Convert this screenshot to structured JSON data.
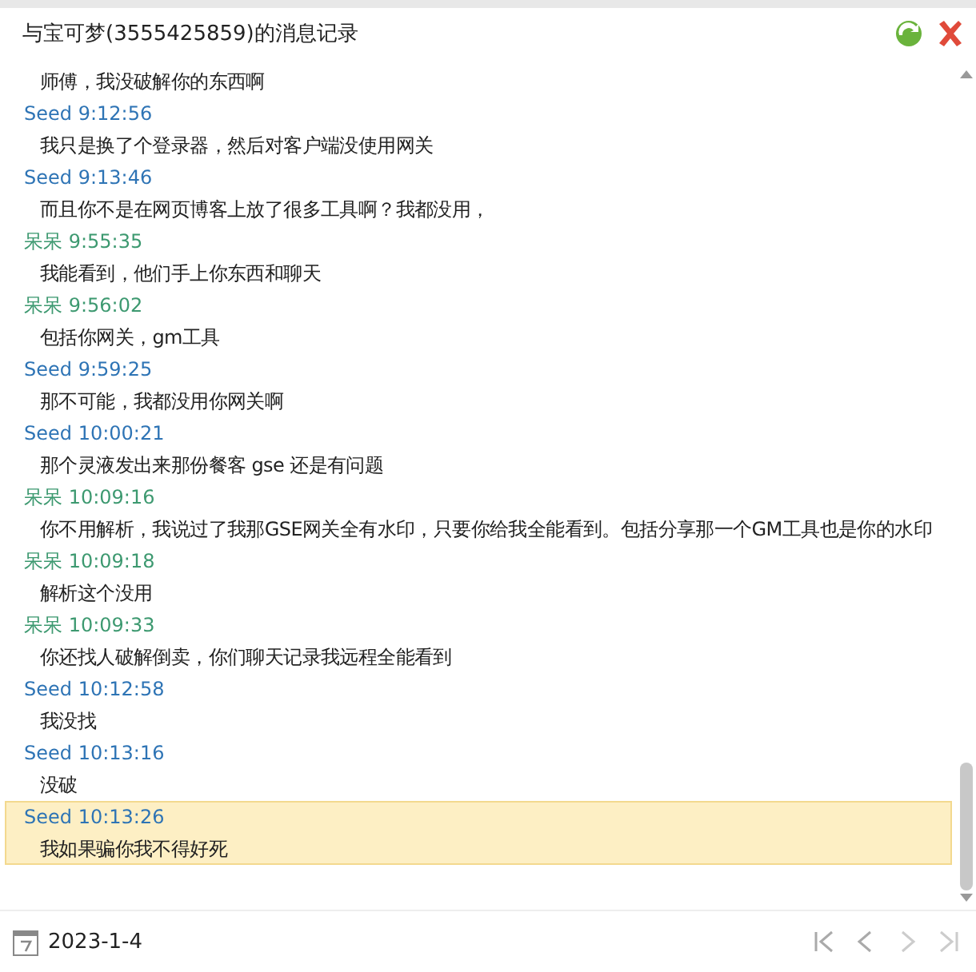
{
  "window": {
    "title": "与宝可梦(3555425859)的消息记录"
  },
  "messages": [
    {
      "text": "师傅，我没破解你的东西啊",
      "selected": false
    },
    {
      "sender": "Seed",
      "time": "9:12:56",
      "color": "#2e74b5",
      "text": "我只是换了个登录器，然后对客户端没使用网关",
      "selected": false
    },
    {
      "sender": "Seed",
      "time": "9:13:46",
      "color": "#2e74b5",
      "text": "而且你不是在网页博客上放了很多工具啊？我都没用，",
      "selected": false
    },
    {
      "sender": "呆呆",
      "time": "9:55:35",
      "color": "#3d9970",
      "text": "我能看到，他们手上你东西和聊天",
      "selected": false
    },
    {
      "sender": "呆呆",
      "time": "9:56:02",
      "color": "#3d9970",
      "text": "包括你网关，gm工具",
      "selected": false
    },
    {
      "sender": "Seed",
      "time": "9:59:25",
      "color": "#2e74b5",
      "text": "那不可能，我都没用你网关啊",
      "selected": false
    },
    {
      "sender": "Seed",
      "time": "10:00:21",
      "color": "#2e74b5",
      "text": "那个灵液发出来那份餐客 gse 还是有问题",
      "selected": false
    },
    {
      "sender": "呆呆",
      "time": "10:09:16",
      "color": "#3d9970",
      "text": "你不用解析，我说过了我那GSE网关全有水印，只要你给我全能看到。包括分享那一个GM工具也是你的水印",
      "selected": false
    },
    {
      "sender": "呆呆",
      "time": "10:09:18",
      "color": "#3d9970",
      "text": "解析这个没用",
      "selected": false
    },
    {
      "sender": "呆呆",
      "time": "10:09:33",
      "color": "#3d9970",
      "text": "你还找人破解倒卖，你们聊天记录我远程全能看到",
      "selected": false
    },
    {
      "sender": "Seed",
      "time": "10:12:58",
      "color": "#2e74b5",
      "text": "我没找",
      "selected": false
    },
    {
      "sender": "Seed",
      "time": "10:13:16",
      "color": "#2e74b5",
      "text": "没破",
      "selected": false
    },
    {
      "sender": "Seed",
      "time": "10:13:26",
      "color": "#2e74b5",
      "text": "我如果骗你我不得好死",
      "selected": true
    }
  ],
  "footer": {
    "date": "2023-1-4"
  }
}
